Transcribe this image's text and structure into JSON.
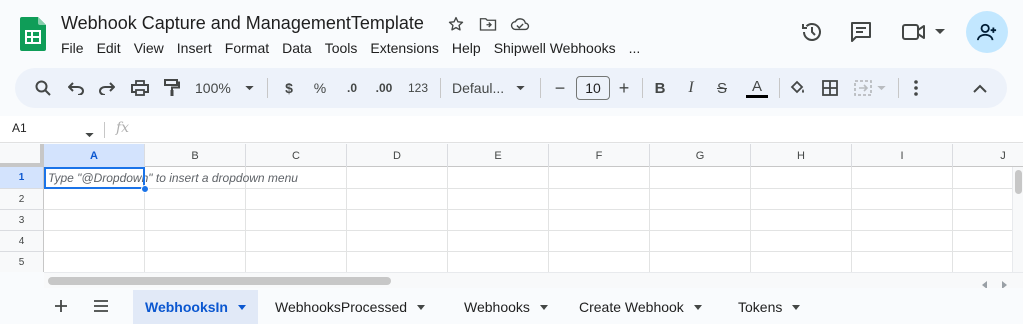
{
  "app": {
    "doc_title": "Webhook Capture and ManagementTemplate",
    "menu": [
      "File",
      "Edit",
      "View",
      "Insert",
      "Format",
      "Data",
      "Tools",
      "Extensions",
      "Help",
      "Shipwell Webhooks",
      "..."
    ]
  },
  "toolbar": {
    "zoom": "100%",
    "currency": "$",
    "percent": "%",
    "dec_decrease": ".0",
    "dec_increase": ".00",
    "number_format": "123",
    "font": "Defaul...",
    "font_size": "10",
    "minus": "−",
    "plus": "+",
    "bold": "B",
    "italic": "I",
    "strike": "S",
    "text_color": "A"
  },
  "formula_bar": {
    "cell_ref": "A1",
    "fx": "fx"
  },
  "grid": {
    "columns": [
      "A",
      "B",
      "C",
      "D",
      "E",
      "F",
      "G",
      "H",
      "I",
      "J"
    ],
    "rows": [
      "1",
      "2",
      "3",
      "4",
      "5"
    ],
    "selected_cell": "A1",
    "hint": "Type \"@Dropdown\"  to insert a dropdown menu"
  },
  "sheets": {
    "tabs": [
      "WebhooksIn",
      "WebhooksProcessed",
      "Webhooks",
      "Create Webhook",
      "Tokens"
    ],
    "active": "WebhooksIn"
  },
  "colors": {
    "accent": "#0b57d0",
    "selection": "#1a73e8",
    "share_bg": "#c2e7ff",
    "sheets_green": "#0f9d58"
  }
}
